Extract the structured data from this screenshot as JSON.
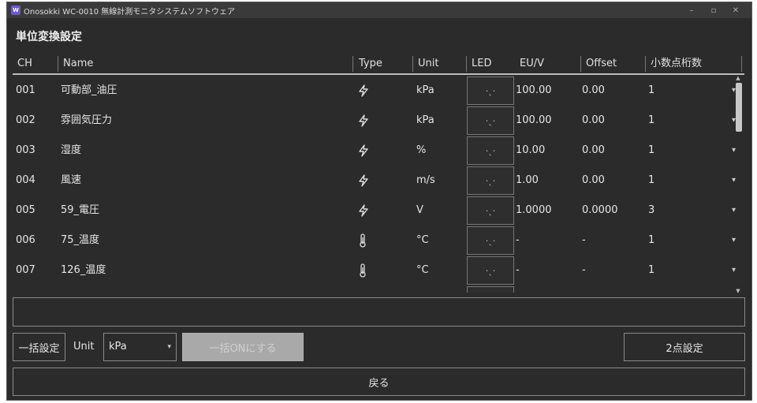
{
  "window": {
    "title": "Onosokki WC-0010 無線計測モニタシステムソフトウェア",
    "controls": [
      "–",
      "▫",
      "✕"
    ]
  },
  "page_title": "単位変換設定",
  "columns": {
    "ch": "CH",
    "name": "Name",
    "type": "Type",
    "unit": "Unit",
    "led": "LED",
    "euv": "EU/V",
    "offset": "Offset",
    "decimals": "小数点桁数"
  },
  "rows": [
    {
      "ch": "001",
      "name": "可動部_油圧",
      "type": "lightning-icon",
      "unit": "kPa",
      "led": "·ˎ·",
      "euv": "100.00",
      "offset": "0.00",
      "decimals": "1"
    },
    {
      "ch": "002",
      "name": "雰囲気圧力",
      "type": "lightning-icon",
      "unit": "kPa",
      "led": "·ˎ·",
      "euv": "100.00",
      "offset": "0.00",
      "decimals": "1"
    },
    {
      "ch": "003",
      "name": "湿度",
      "type": "lightning-icon",
      "unit": "%",
      "led": "·ˎ·",
      "euv": "10.00",
      "offset": "0.00",
      "decimals": "1"
    },
    {
      "ch": "004",
      "name": "風速",
      "type": "lightning-icon",
      "unit": "m/s",
      "led": "·ˎ·",
      "euv": "1.00",
      "offset": "0.00",
      "decimals": "1"
    },
    {
      "ch": "005",
      "name": "59_電圧",
      "type": "lightning-icon",
      "unit": "V",
      "led": "·ˎ·",
      "euv": "1.0000",
      "offset": "0.0000",
      "decimals": "3"
    },
    {
      "ch": "006",
      "name": "75_温度",
      "type": "thermometer-icon",
      "unit": "°C",
      "led": "·ˎ·",
      "euv": "-",
      "offset": "-",
      "decimals": "1"
    },
    {
      "ch": "007",
      "name": "126_温度",
      "type": "thermometer-icon",
      "unit": "°C",
      "led": "·ˎ·",
      "euv": "-",
      "offset": "-",
      "decimals": "1"
    }
  ],
  "dropdown_glyph": "▾",
  "controls": {
    "bulk_set_label": "一括設定",
    "unit_label": "Unit",
    "unit_value": "kPa",
    "bulk_on_label": "一括ONにする",
    "two_point_label": "2点設定",
    "back_label": "戻る"
  },
  "colors": {
    "background": "#2b2b2b",
    "border": "#8a8a8a",
    "disabled_button": "#a9a9a9"
  }
}
